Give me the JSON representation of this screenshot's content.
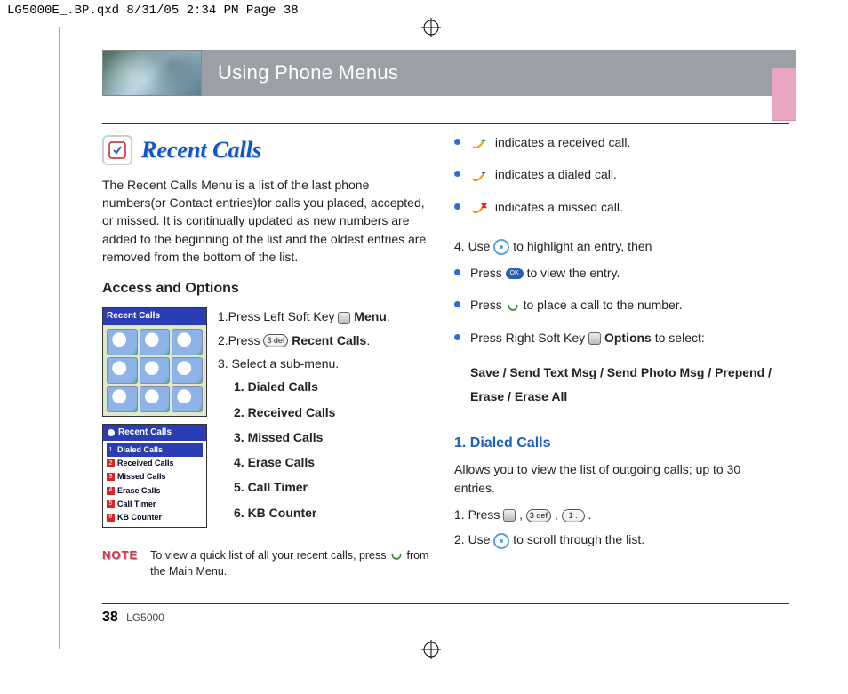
{
  "crop_header": "LG5000E_.BP.qxd  8/31/05  2:34 PM  Page 38",
  "header": {
    "title": "Using Phone Menus"
  },
  "section": {
    "title": "Recent Calls",
    "intro": "The Recent Calls Menu is a list of the last phone numbers(or Contact entries)for calls you placed, accepted, or missed. It is continually updated as new numbers are added to the beginning of the list and the oldest entries are removed from the bottom of the list.",
    "access_heading": "Access and Options",
    "steps": {
      "s1_pre": "1.Press Left Soft Key ",
      "s1_b": "Menu",
      "s2_pre": "2.Press ",
      "s2_key": "3 def",
      "s2_b": "Recent Calls",
      "s3": "3. Select a sub-menu.",
      "subs": [
        "1. Dialed Calls",
        "2. Received Calls",
        "3. Missed Calls",
        "4. Erase Calls",
        "5. Call Timer",
        "6. KB Counter"
      ]
    },
    "note_label": "NOTE",
    "note_text_a": "To view a quick list of all your recent calls, press ",
    "note_text_b": " from the Main Menu.",
    "screenshot1_title": "Recent Calls",
    "screenshot2_title": "Recent Calls",
    "screenshot2_items": [
      {
        "n": "1",
        "color": "#2a3db5",
        "label": "Dialed Calls",
        "hl": true
      },
      {
        "n": "2",
        "color": "#d22",
        "label": "Received Calls"
      },
      {
        "n": "3",
        "color": "#d22",
        "label": "Missed Calls"
      },
      {
        "n": "4",
        "color": "#d22",
        "label": "Erase Calls"
      },
      {
        "n": "5",
        "color": "#d22",
        "label": "Call Timer"
      },
      {
        "n": "6",
        "color": "#d22",
        "label": "KB Counter"
      }
    ]
  },
  "right": {
    "legend": [
      "indicates a received call.",
      "indicates a dialed call.",
      "indicates a missed call."
    ],
    "step4": "4.  Use ",
    "step4_b": " to highlight an entry, then",
    "bullets": [
      {
        "pre": "Press ",
        "post": " to view the entry.",
        "key": "ok"
      },
      {
        "pre": "Press ",
        "post": " to place a call to the number.",
        "key": "send"
      },
      {
        "pre": "Press Right Soft Key ",
        "bold": "Options",
        "post": " to select:",
        "key": "soft"
      }
    ],
    "options_line": "Save / Send Text Msg / Send Photo Msg / Prepend / Erase / Erase All",
    "dialed": {
      "heading": "1. Dialed Calls",
      "desc": "Allows you to view the list of outgoing calls; up to 30 entries.",
      "s1_pre": "1.  Press ",
      "s1_keys": [
        "soft",
        "3 def",
        "1 ."
      ],
      "s2_pre": "2.  Use ",
      "s2_post": " to scroll through the list."
    }
  },
  "footer": {
    "page": "38",
    "model": "LG5000"
  }
}
